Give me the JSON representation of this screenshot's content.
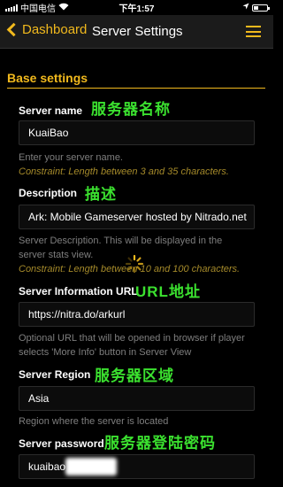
{
  "status": {
    "carrier": "中国电信",
    "time": "下午1:57"
  },
  "nav": {
    "back_label": "Dashboard",
    "title": "Server Settings"
  },
  "section": {
    "title": "Base settings"
  },
  "fields": {
    "server_name": {
      "label": "Server name",
      "annotation": "服务器名称",
      "value": "KuaiBao",
      "hint": "Enter your server name.",
      "constraint": "Constraint: Length between 3 and 35 characters."
    },
    "description": {
      "label": "Description",
      "annotation": "描述",
      "value": "Ark: Mobile Gameserver hosted by Nitrado.net",
      "hint": "Server Description. This will be displayed in the server stats view.",
      "constraint": "Constraint: Length between 10 and 100 characters."
    },
    "info_url": {
      "label": "Server Information URL",
      "annotation": "URL地址",
      "value": "https://nitra.do/arkurl",
      "hint": "Optional URL that will be opened in browser if player selects 'More Info' button in Server View"
    },
    "region": {
      "label": "Server Region",
      "annotation": "服务器区域",
      "value": "Asia",
      "hint": "Region where the server is located"
    },
    "password": {
      "label": "Server password",
      "annotation": "服务器登陆密码",
      "value": "kuaibao"
    }
  },
  "colors": {
    "accent": "#f1b91d",
    "annotation": "#3be12f",
    "background": "#000000"
  },
  "icons": {
    "back": "chevron-left-icon",
    "menu": "hamburger-menu-icon",
    "loading": "spinner-icon"
  }
}
